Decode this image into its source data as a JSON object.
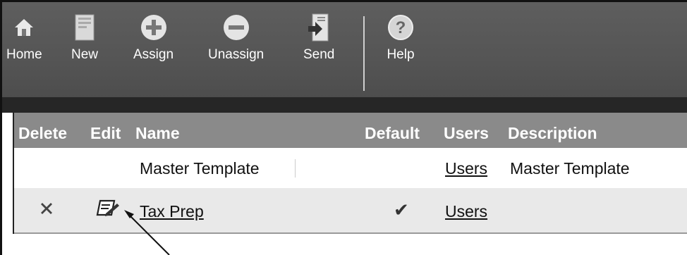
{
  "toolbar": {
    "items": [
      {
        "label": "Home",
        "icon": "home-icon"
      },
      {
        "label": "New",
        "icon": "new-document-icon"
      },
      {
        "label": "Assign",
        "icon": "plus-circle-icon"
      },
      {
        "label": "Unassign",
        "icon": "minus-circle-icon"
      },
      {
        "label": "Send",
        "icon": "send-icon"
      },
      {
        "label": "Help",
        "icon": "help-icon"
      }
    ]
  },
  "table": {
    "headers": {
      "delete": "Delete",
      "edit": "Edit",
      "name": "Name",
      "default": "Default",
      "users": "Users",
      "description": "Description"
    },
    "rows": [
      {
        "name": "Master Template",
        "default": "",
        "users": "Users",
        "description": "Master Template"
      },
      {
        "name": "Tax Prep",
        "default": "✔",
        "users": "Users",
        "description": ""
      }
    ]
  },
  "icons": {
    "delete": "delete-x-icon",
    "edit": "edit-icon",
    "default": "checkmark-icon",
    "callout": "arrow-pointer"
  },
  "colors": {
    "toolbar": "#555555",
    "header": "#8a8a8a",
    "row_alt": "#e9e9e9"
  }
}
